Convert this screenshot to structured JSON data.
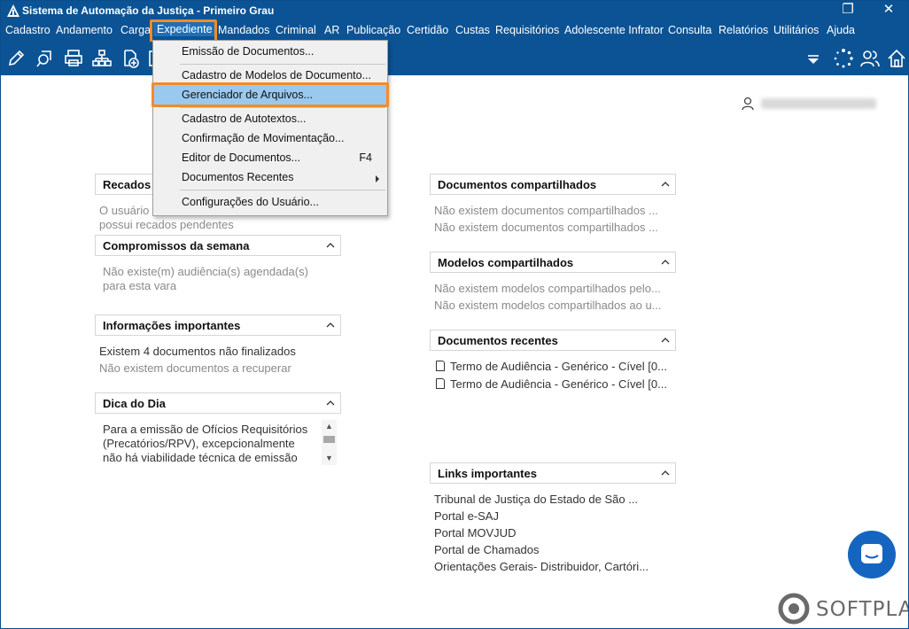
{
  "window": {
    "title": "Sistema de Automação da Justiça - Primeiro Grau",
    "restore_glyph": "❐",
    "close_glyph": "✕"
  },
  "menubar": {
    "items": [
      "Cadastro",
      "Andamento",
      "Carga",
      "Expediente",
      "Mandados",
      "Criminal",
      "AR",
      "Publicação",
      "Certidão",
      "Custas",
      "Requisitórios",
      "Adolescente Infrator",
      "Consulta",
      "Relatórios",
      "Utilitários",
      "Ajuda"
    ],
    "active": "Expediente"
  },
  "toolbar": {
    "icons": [
      "edit-icon",
      "search-document-icon",
      "printer-icon",
      "org-chart-icon",
      "add-document-icon",
      "funnel-icon",
      "loading-icon",
      "users-icon",
      "home-icon"
    ]
  },
  "dropdown": {
    "items": [
      {
        "label": "Emissão de Documentos...",
        "shortcut": ""
      },
      {
        "label": "Cadastro de Modelos de Documento...",
        "shortcut": ""
      },
      {
        "label": "Gerenciador de Arquivos...",
        "shortcut": ""
      },
      {
        "label": "Cadastro de Autotextos...",
        "shortcut": ""
      },
      {
        "label": "Confirmação de Movimentação...",
        "shortcut": ""
      },
      {
        "label": "Editor de Documentos...",
        "shortcut": "F4"
      },
      {
        "label": "Documentos Recentes",
        "shortcut": ""
      },
      {
        "label": "Configurações do Usuário...",
        "shortcut": ""
      }
    ],
    "selected": "Gerenciador de Arquivos..."
  },
  "left_panels": {
    "recados": {
      "title": "Recados",
      "lines": [
        "O usuário",
        "possui recados pendentes"
      ]
    },
    "compromissos": {
      "title": "Compromissos da semana",
      "lines": [
        "Não existe(m) audiência(s) agendada(s)",
        "para esta vara"
      ]
    },
    "informacoes": {
      "title": "Informações importantes",
      "lines": [
        "Existem 4 documentos não finalizados",
        "Não existem documentos a recuperar"
      ]
    },
    "dica": {
      "title": "Dica do Dia",
      "lines": [
        "Para a emissão de Ofícios Requisitórios",
        "(Precatórios/RPV), excepcionalmente",
        "não há viabilidade técnica de emissão"
      ]
    }
  },
  "right_panels": {
    "doc_compartilhados": {
      "title": "Documentos compartilhados",
      "lines": [
        "Não existem documentos compartilhados ...",
        "Não existem documentos compartilhados ..."
      ]
    },
    "modelos_compartilhados": {
      "title": "Modelos compartilhados",
      "lines": [
        "Não existem modelos compartilhados pelo...",
        "Não existem modelos compartilhados ao u..."
      ]
    },
    "doc_recentes": {
      "title": "Documentos recentes",
      "lines": [
        "Termo de Audiência - Genérico - Cível [0...",
        "Termo de Audiência - Genérico - Cível [0..."
      ]
    },
    "links": {
      "title": "Links importantes",
      "lines": [
        "Tribunal de Justiça do Estado de São ...",
        "Portal e-SAJ",
        "Portal MOVJUD",
        "Portal de Chamados",
        "Orientações Gerais- Distribuidor, Cartóri..."
      ]
    }
  },
  "branding": {
    "logo_text": "SOFTPLAN"
  },
  "colors": {
    "titlebar": "#0b5394",
    "highlight": "#f28c28",
    "selected_item": "#99c9ef",
    "chat": "#1565c0"
  }
}
